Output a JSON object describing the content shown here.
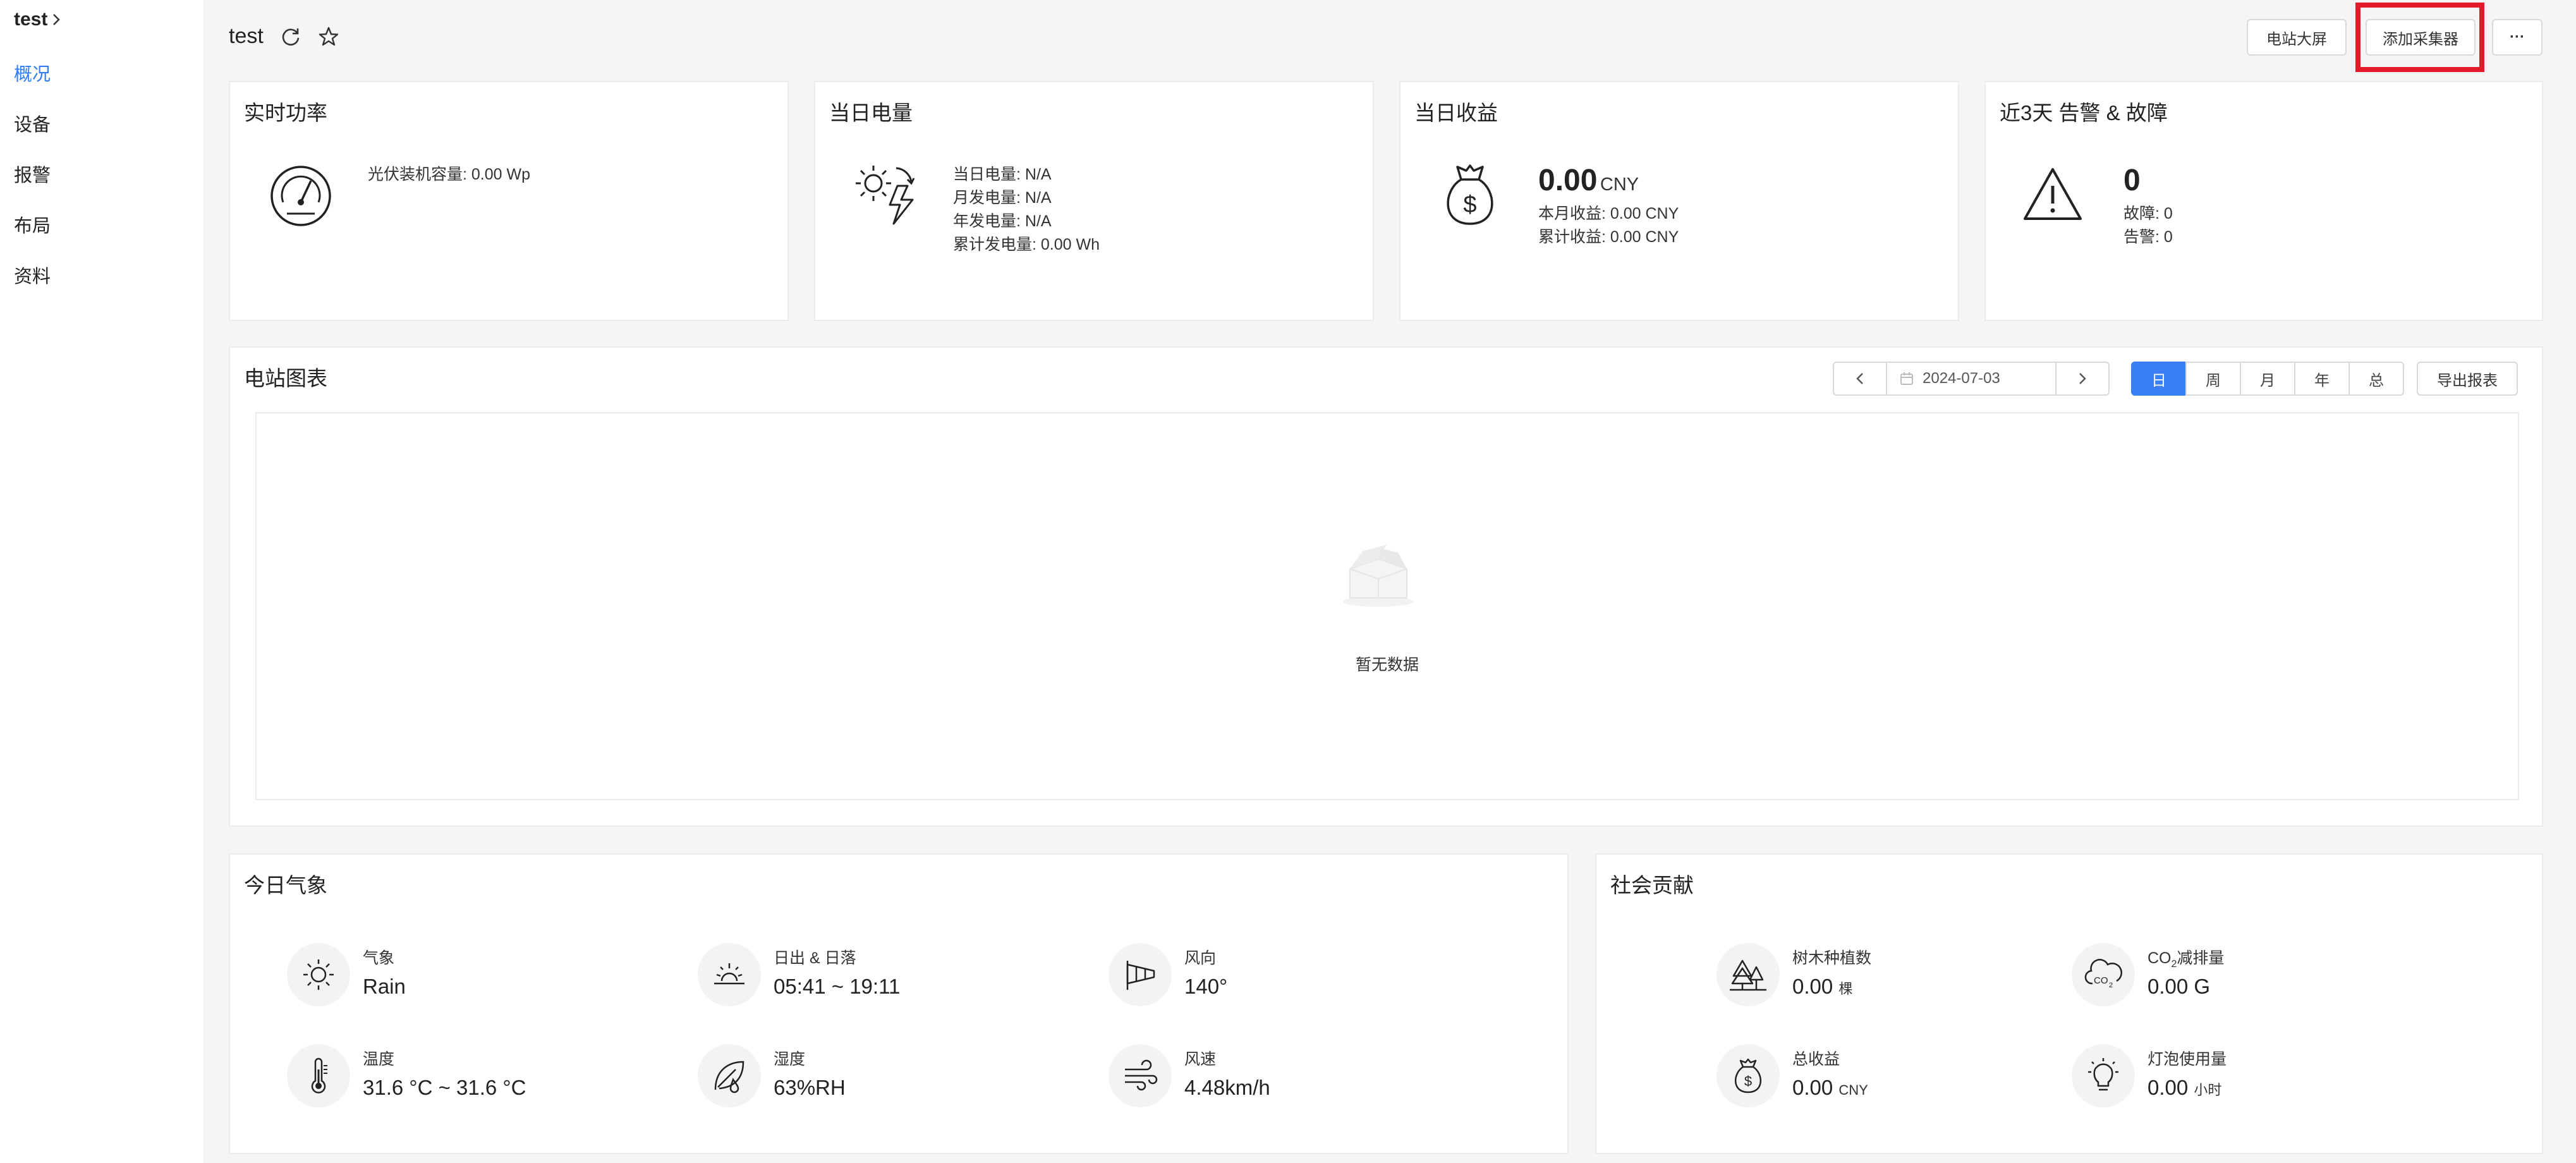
{
  "sidebar": {
    "title": "test",
    "items": [
      {
        "label": "概况",
        "active": true
      },
      {
        "label": "设备"
      },
      {
        "label": "报警"
      },
      {
        "label": "布局"
      },
      {
        "label": "资料"
      }
    ]
  },
  "header": {
    "title": "test",
    "buttons": {
      "big_screen": "电站大屏",
      "add_collector": "添加采集器",
      "more": "···"
    }
  },
  "cards": {
    "power": {
      "title": "实时功率",
      "capacity": "光伏装机容量: 0.00 Wp"
    },
    "energy": {
      "title": "当日电量",
      "day": "当日电量: N/A",
      "month": "月发电量: N/A",
      "year": "年发电量: N/A",
      "total": "累计发电量: 0.00 Wh"
    },
    "revenue": {
      "title": "当日收益",
      "value": "0.00",
      "unit": "CNY",
      "month": "本月收益: 0.00 CNY",
      "total": "累计收益: 0.00 CNY"
    },
    "alarms": {
      "title": "近3天 告警 & 故障",
      "value": "0",
      "faults": "故障: 0",
      "alarms": "告警: 0"
    }
  },
  "chart_panel": {
    "title": "电站图表",
    "date": "2024-07-03",
    "periods": [
      "日",
      "周",
      "月",
      "年",
      "总"
    ],
    "active_period": "日",
    "export": "导出报表",
    "empty": "暂无数据"
  },
  "weather": {
    "title": "今日气象",
    "items": [
      {
        "label": "气象",
        "value": "Rain",
        "icon": "sun-icon"
      },
      {
        "label": "日出 & 日落",
        "value": "05:41 ~ 19:11",
        "icon": "sunrise-icon"
      },
      {
        "label": "风向",
        "value": "140°",
        "icon": "windsock-icon"
      },
      {
        "label": "温度",
        "value": "31.6 °C ~ 31.6 °C",
        "icon": "thermometer-icon"
      },
      {
        "label": "湿度",
        "value": "63%RH",
        "icon": "humidity-icon"
      },
      {
        "label": "风速",
        "value": "4.48km/h",
        "icon": "wind-icon"
      }
    ]
  },
  "social": {
    "title": "社会贡献",
    "items": [
      {
        "label": "树木种植数",
        "value": "0.00",
        "unit": "棵",
        "icon": "trees-icon"
      },
      {
        "label_prefix": "CO",
        "label_sub": "2",
        "label_suffix": "减排量",
        "value": "0.00 G",
        "icon": "co2-cloud-icon"
      },
      {
        "label": "总收益",
        "value": "0.00",
        "unit": "CNY",
        "icon": "money-bag-icon"
      },
      {
        "label": "灯泡使用量",
        "value": "0.00",
        "unit": "小时",
        "icon": "bulb-icon"
      }
    ]
  },
  "colors": {
    "accent": "#3b7ff6",
    "highlight": "#e21b2a"
  }
}
